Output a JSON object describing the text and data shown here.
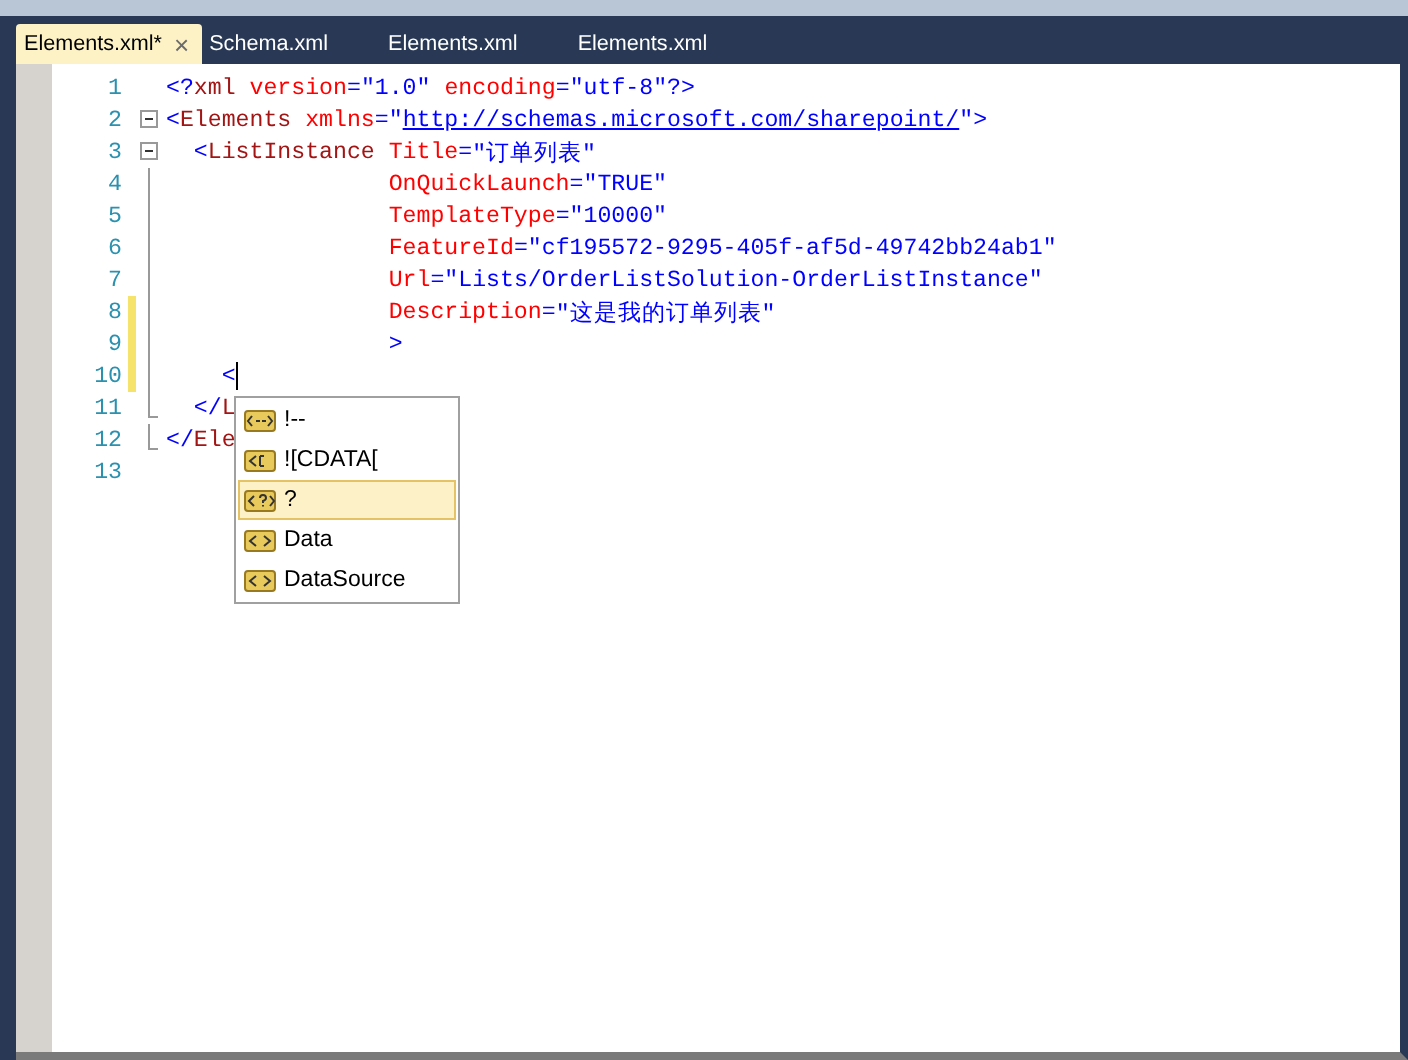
{
  "tabs": [
    {
      "label": "Elements.xml*",
      "selected": true,
      "close": "×"
    },
    {
      "label": "Schema.xml",
      "selected": false
    },
    {
      "label": "Elements.xml",
      "selected": false
    },
    {
      "label": "Elements.xml",
      "selected": false
    }
  ],
  "editor": {
    "lines": [
      {
        "number": "1",
        "changed": false,
        "kind": "plain",
        "tokens": [
          {
            "kind": "punct",
            "text": "<?"
          },
          {
            "kind": "tag",
            "text": "xml"
          },
          {
            "kind": "attr",
            "text": " version"
          },
          {
            "kind": "punct",
            "text": "="
          },
          {
            "kind": "value",
            "text": "\"1.0\""
          },
          {
            "kind": "attr",
            "text": " encoding"
          },
          {
            "kind": "punct",
            "text": "="
          },
          {
            "kind": "value",
            "text": "\"utf-8\""
          },
          {
            "kind": "punct",
            "text": "?>"
          }
        ]
      },
      {
        "number": "2",
        "changed": false,
        "kind": "fold_start",
        "tokens": [
          {
            "kind": "punct",
            "text": "<"
          },
          {
            "kind": "tag",
            "text": "Elements"
          },
          {
            "kind": "attr",
            "text": " xmlns"
          },
          {
            "kind": "punct",
            "text": "=\""
          },
          {
            "kind": "link",
            "text": "http://schemas.microsoft.com/sharepoint/"
          },
          {
            "kind": "punct",
            "text": "\">"
          }
        ]
      },
      {
        "number": "3",
        "changed": false,
        "kind": "fold_start",
        "tokens": [
          {
            "kind": "punct",
            "text": "  <"
          },
          {
            "kind": "tag",
            "text": "ListInstance"
          },
          {
            "kind": "attr",
            "text": " Title"
          },
          {
            "kind": "punct",
            "text": "="
          },
          {
            "kind": "value",
            "text": "\"订单列表\""
          }
        ]
      },
      {
        "number": "4",
        "changed": false,
        "kind": "fold_inside",
        "tokens": [
          {
            "kind": "attr",
            "text": "                OnQuickLaunch"
          },
          {
            "kind": "punct",
            "text": "="
          },
          {
            "kind": "value",
            "text": "\"TRUE\""
          }
        ]
      },
      {
        "number": "5",
        "changed": false,
        "kind": "fold_inside",
        "tokens": [
          {
            "kind": "attr",
            "text": "                TemplateType"
          },
          {
            "kind": "punct",
            "text": "="
          },
          {
            "kind": "value",
            "text": "\"10000\""
          }
        ]
      },
      {
        "number": "6",
        "changed": false,
        "kind": "fold_inside",
        "tokens": [
          {
            "kind": "attr",
            "text": "                FeatureId"
          },
          {
            "kind": "punct",
            "text": "="
          },
          {
            "kind": "value",
            "text": "\"cf195572-9295-405f-af5d-49742bb24ab1\""
          }
        ]
      },
      {
        "number": "7",
        "changed": false,
        "kind": "fold_inside",
        "tokens": [
          {
            "kind": "attr",
            "text": "                Url"
          },
          {
            "kind": "punct",
            "text": "="
          },
          {
            "kind": "value",
            "text": "\"Lists/OrderListSolution-OrderListInstance\""
          }
        ]
      },
      {
        "number": "8",
        "changed": true,
        "kind": "fold_inside",
        "tokens": [
          {
            "kind": "attr",
            "text": "                Description"
          },
          {
            "kind": "punct",
            "text": "="
          },
          {
            "kind": "value",
            "text": "\"这是我的订单列表\""
          }
        ]
      },
      {
        "number": "9",
        "changed": true,
        "kind": "fold_inside",
        "tokens": [
          {
            "kind": "punct",
            "text": "                >"
          }
        ]
      },
      {
        "number": "10",
        "changed": true,
        "kind": "fold_inside",
        "caret": true,
        "tokens": [
          {
            "kind": "punct",
            "text": "    <"
          }
        ]
      },
      {
        "number": "11",
        "changed": false,
        "kind": "fold_end",
        "tokens": [
          {
            "kind": "punct",
            "text": "  </"
          },
          {
            "kind": "tag",
            "text": "L"
          }
        ]
      },
      {
        "number": "12",
        "changed": false,
        "kind": "fold_end",
        "tokens": [
          {
            "kind": "punct",
            "text": "</"
          },
          {
            "kind": "tag",
            "text": "Ele"
          }
        ]
      },
      {
        "number": "13",
        "changed": false,
        "kind": "plain"
      }
    ]
  },
  "completion": {
    "items": [
      {
        "label": "!--",
        "kind": "comment",
        "selected": false
      },
      {
        "label": "![CDATA[",
        "kind": "cdata",
        "selected": false
      },
      {
        "label": "?",
        "kind": "instruction",
        "selected": true
      },
      {
        "label": "Data",
        "kind": "element",
        "selected": false
      },
      {
        "label": "DataSource",
        "kind": "element",
        "selected": false
      }
    ]
  }
}
